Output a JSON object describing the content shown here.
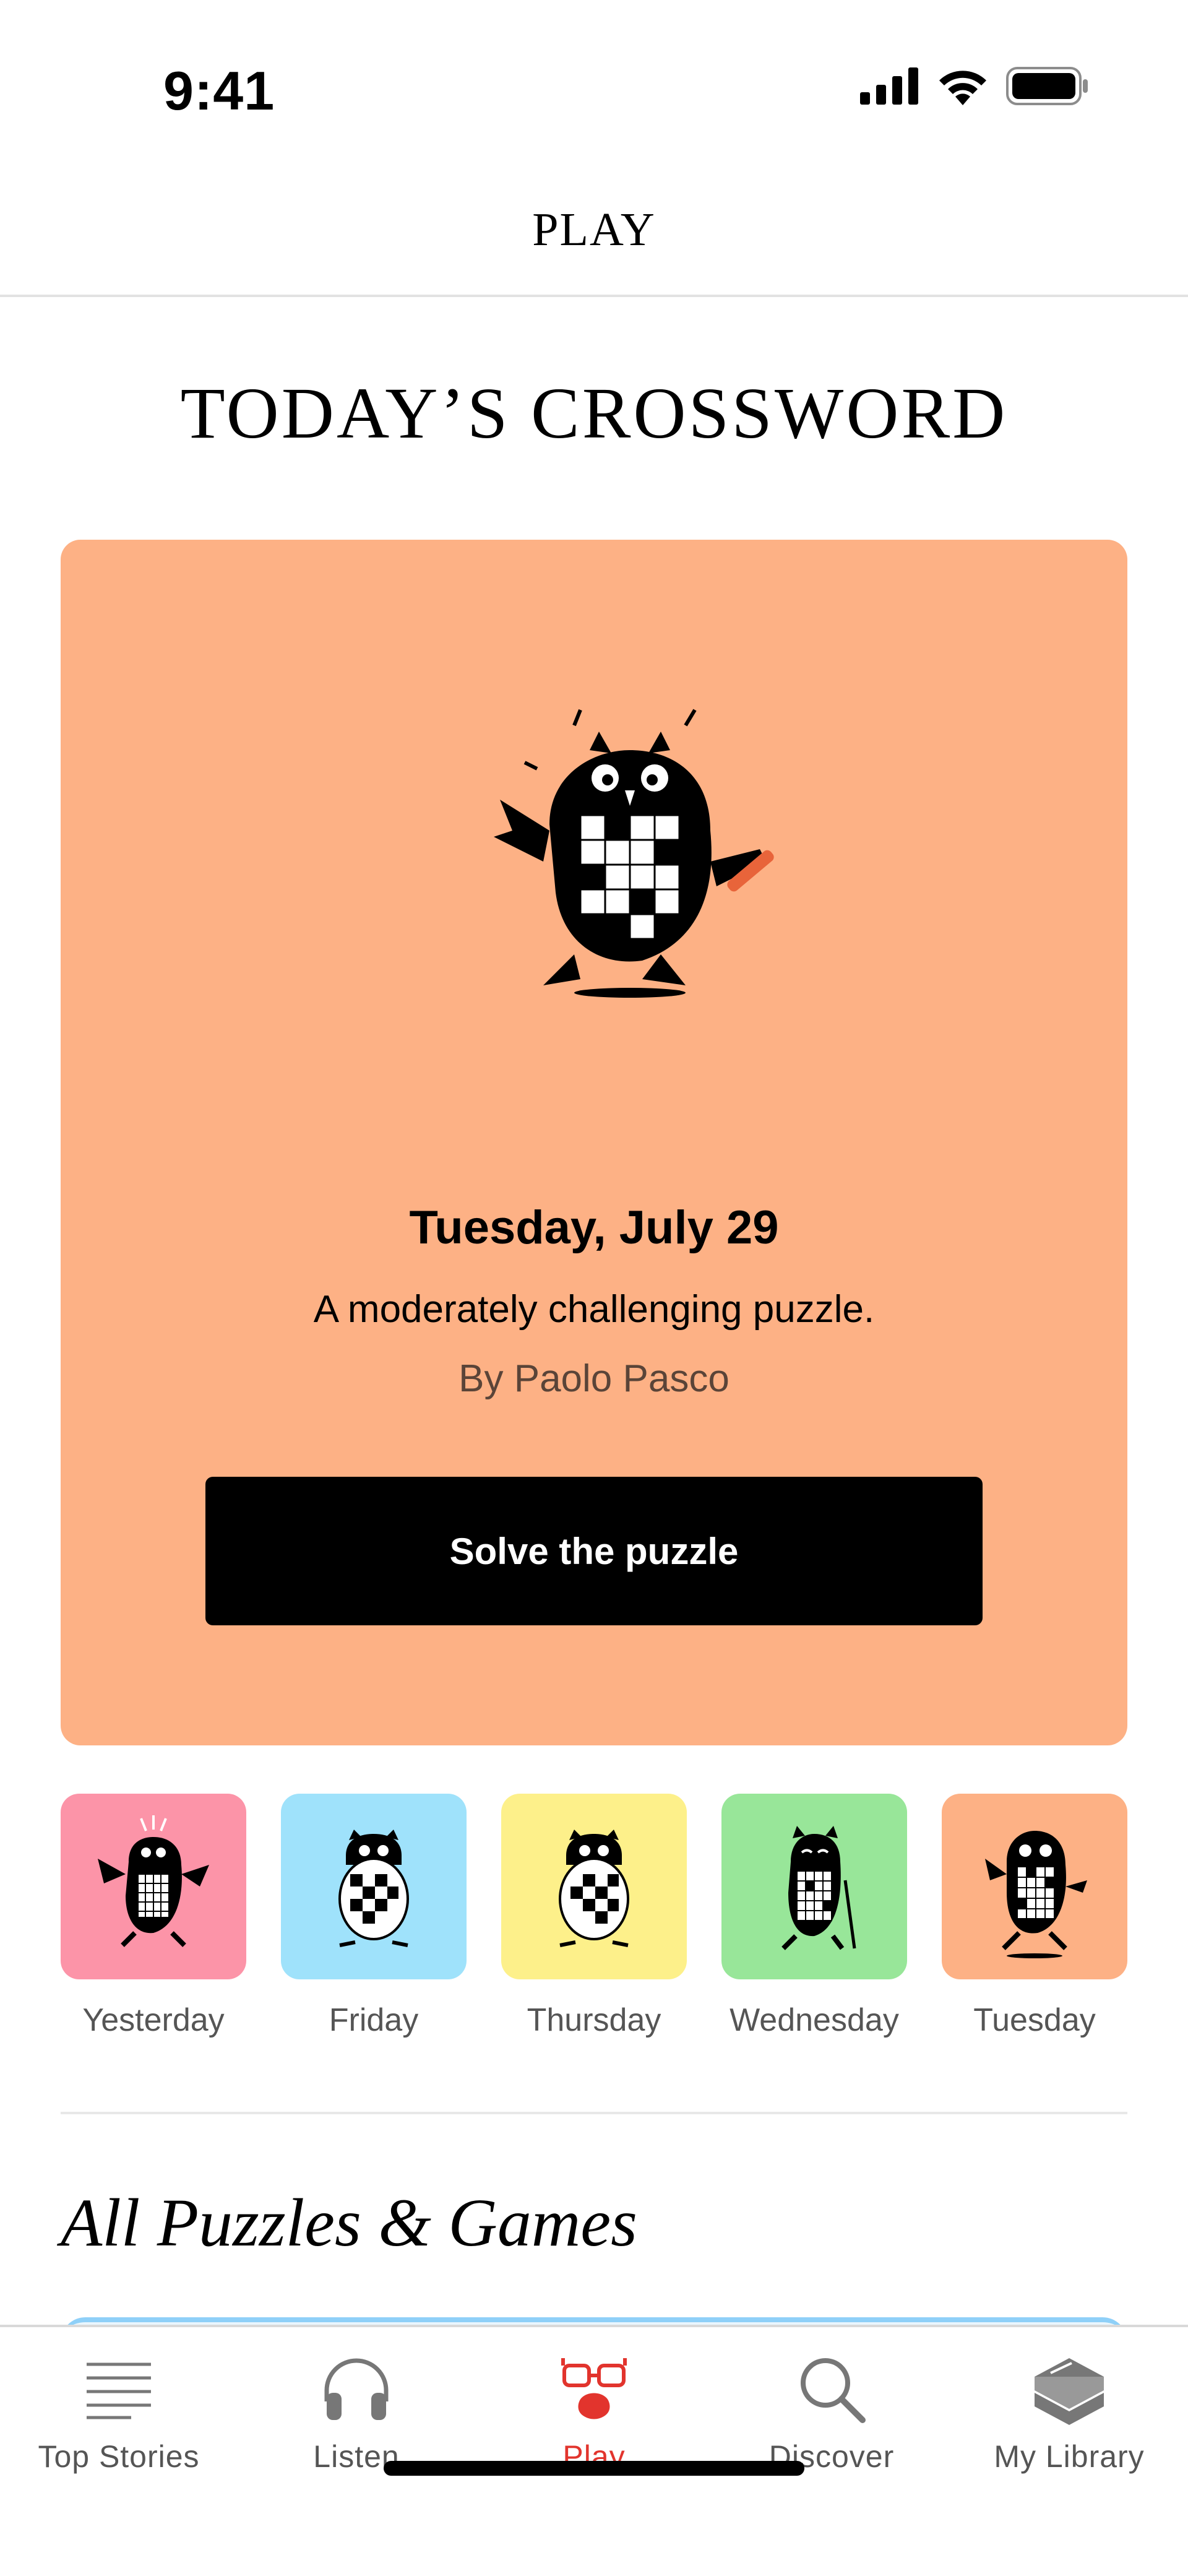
{
  "status_bar": {
    "time": "9:41"
  },
  "header": {
    "title": "PLAY"
  },
  "section": {
    "title": "TODAY’S CROSSWORD"
  },
  "hero": {
    "date": "Tuesday, July 29",
    "description": "A moderately challenging puzzle.",
    "byline": "By Paolo Pasco",
    "button_label": "Solve the puzzle",
    "background_color": "#fdb185"
  },
  "past_puzzles": [
    {
      "label": "Yesterday",
      "color": "#fc94a8",
      "icon": "owl-cheering-icon"
    },
    {
      "label": "Friday",
      "color": "#9fe2fb",
      "icon": "owl-egg-icon"
    },
    {
      "label": "Thursday",
      "color": "#fdf08a",
      "icon": "owl-egg-icon"
    },
    {
      "label": "Wednesday",
      "color": "#98e699",
      "icon": "owl-cane-icon"
    },
    {
      "label": "Tuesday",
      "color": "#fdb185",
      "icon": "owl-running-icon"
    }
  ],
  "games_section": {
    "title": "All Puzzles & Games"
  },
  "tab_bar": {
    "active_color": "#e2342d",
    "items": [
      {
        "label": "Top Stories",
        "icon": "lines-icon"
      },
      {
        "label": "Listen",
        "icon": "headphones-icon"
      },
      {
        "label": "Play",
        "icon": "play-glasses-icon",
        "active": true
      },
      {
        "label": "Discover",
        "icon": "search-icon"
      },
      {
        "label": "My Library",
        "icon": "books-icon"
      }
    ]
  }
}
